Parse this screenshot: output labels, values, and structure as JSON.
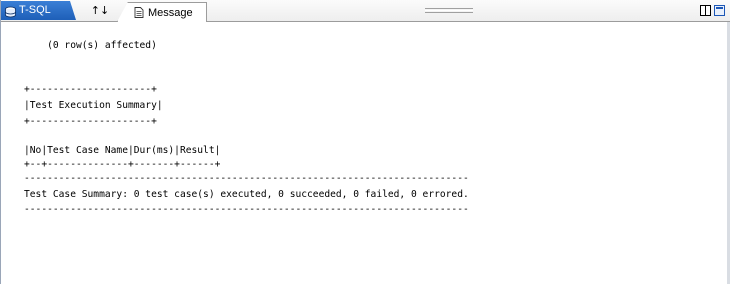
{
  "tabs": {
    "tsql_label": "T-SQL",
    "sort_label": "↑↓",
    "message_label": "Message"
  },
  "output": {
    "lines": [
      "    (0 row(s) affected)",
      "+---------------------+",
      "|Test Execution Summary|",
      "+---------------------+",
      "|No|Test Case Name|Dur(ms)|Result|",
      "+--+--------------+-------+------+",
      "-----------------------------------------------------------------------------",
      "Test Case Summary: 0 test case(s) executed, 0 succeeded, 0 failed, 0 errored.",
      "-----------------------------------------------------------------------------"
    ]
  },
  "colors": {
    "active_tab": "#1e5fb8",
    "maximize_button": "#1c57b6"
  },
  "icons": {
    "tsql": "database-icon",
    "sort": "sort-arrows-icon",
    "message": "document-icon",
    "tile": "tile-view-icon",
    "maximize": "maximize-view-icon"
  }
}
